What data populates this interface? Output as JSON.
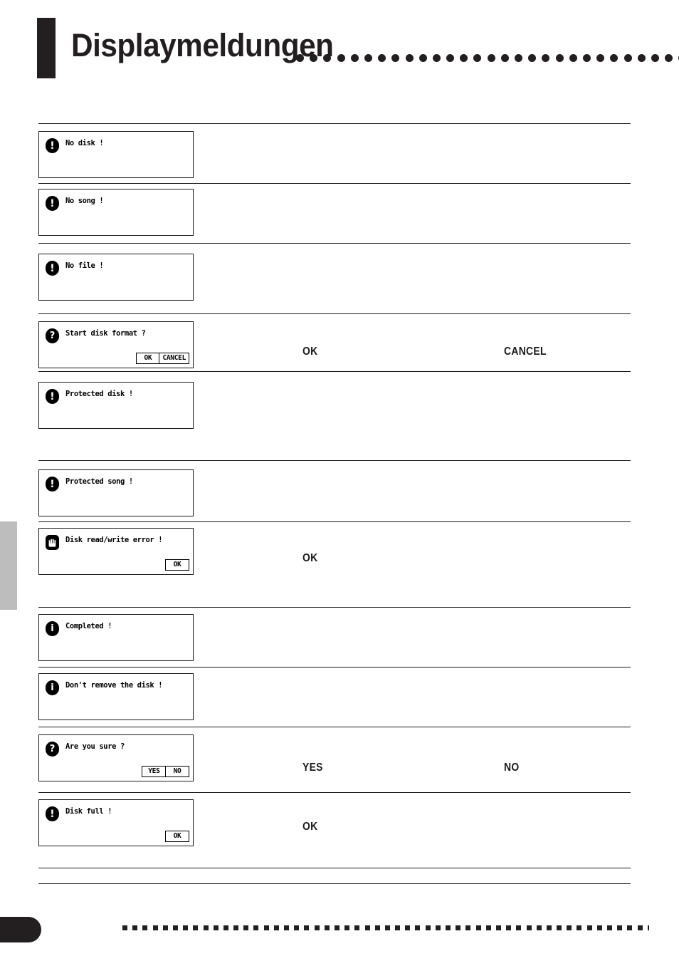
{
  "header": {
    "title": "Displaymeldungen",
    "dot_count": 34,
    "bar_color": "#231f20"
  },
  "side_tab": {
    "label": "",
    "color": "#bdbdbd"
  },
  "messages": [
    {
      "id": "no-disk",
      "icon": "exclamation-icon",
      "icon_glyph": "!",
      "lcd_text": "No disk !",
      "buttons": [],
      "terms": []
    },
    {
      "id": "no-song",
      "icon": "exclamation-icon",
      "icon_glyph": "!",
      "lcd_text": "No song !",
      "buttons": [],
      "terms": []
    },
    {
      "id": "no-file",
      "icon": "exclamation-icon",
      "icon_glyph": "!",
      "lcd_text": "No file !",
      "buttons": [],
      "terms": []
    },
    {
      "id": "start-disk-format",
      "icon": "question-icon",
      "icon_glyph": "?",
      "lcd_text": "Start disk format ?",
      "buttons": [
        "OK",
        "CANCEL"
      ],
      "terms": [
        "OK",
        "CANCEL"
      ]
    },
    {
      "id": "protected-disk",
      "icon": "exclamation-icon",
      "icon_glyph": "!",
      "lcd_text": "Protected disk !",
      "buttons": [],
      "terms": []
    },
    {
      "id": "protected-song",
      "icon": "exclamation-icon",
      "icon_glyph": "!",
      "lcd_text": "Protected song !",
      "buttons": [],
      "terms": []
    },
    {
      "id": "disk-read-write-error",
      "icon": "hand-stop-icon",
      "icon_glyph": "",
      "lcd_text": "Disk read/write error !",
      "buttons": [
        "OK"
      ],
      "terms": [
        "OK"
      ]
    },
    {
      "id": "completed",
      "icon": "info-icon",
      "icon_glyph": "i",
      "lcd_text": "Completed !",
      "buttons": [],
      "terms": []
    },
    {
      "id": "dont-remove-the-disk",
      "icon": "info-icon",
      "icon_glyph": "i",
      "lcd_text": "Don't remove the disk !",
      "buttons": [],
      "terms": []
    },
    {
      "id": "are-you-sure",
      "icon": "question-icon",
      "icon_glyph": "?",
      "lcd_text": "Are you sure ?",
      "buttons": [
        "YES",
        "NO"
      ],
      "terms": [
        "YES",
        "NO"
      ]
    },
    {
      "id": "disk-full",
      "icon": "exclamation-icon",
      "icon_glyph": "!",
      "lcd_text": "Disk full !",
      "buttons": [
        "OK"
      ],
      "terms": [
        "OK"
      ]
    }
  ],
  "footer": {
    "page_number": "",
    "dot_count": 60
  }
}
